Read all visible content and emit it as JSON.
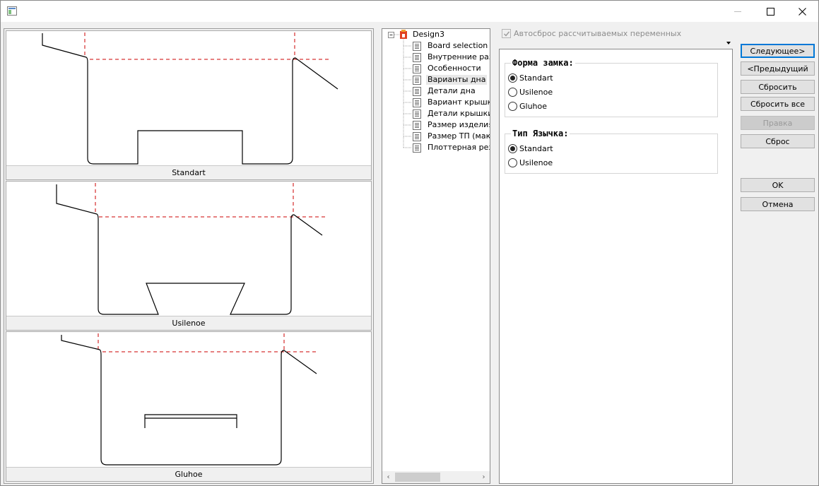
{
  "titlebar": {
    "icons": {
      "app": "app-window-icon",
      "minimize": "minimize-icon",
      "maximize": "maximize-icon",
      "close": "close-icon"
    }
  },
  "preview": {
    "items": [
      {
        "caption": "Standart"
      },
      {
        "caption": "Usilenoe"
      },
      {
        "caption": "Gluhoe"
      }
    ],
    "colors": {
      "outline": "#000000",
      "fold_line": "#cc0000"
    }
  },
  "tree": {
    "root": {
      "label": "Design3",
      "icon": "design-folder-icon"
    },
    "items": [
      {
        "label": "Board selection"
      },
      {
        "label": "Внутренние разме"
      },
      {
        "label": "Особенности"
      },
      {
        "label": "Варианты дна"
      },
      {
        "label": "Детали дна"
      },
      {
        "label": "Вариант крышки"
      },
      {
        "label": "Детали крышки"
      },
      {
        "label": "Размер изделия"
      },
      {
        "label": "Размер ТП (макс Г"
      },
      {
        "label": "Плоттерная резка"
      }
    ],
    "selected_index": 3,
    "scroll": {
      "left": "‹",
      "right": "›"
    }
  },
  "autoreset": {
    "label": "Автосброс рассчитываемых переменных",
    "checked": true
  },
  "options": {
    "lock_group": {
      "title": "Форма замка:",
      "options": [
        "Standart",
        "Usilenoe",
        "Gluhoe"
      ],
      "selected": "Standart"
    },
    "tongue_group": {
      "title": "Тип Язычка:",
      "options": [
        "Standart",
        "Usilenoe"
      ],
      "selected": "Standart"
    }
  },
  "buttons": {
    "next": "Следующее>",
    "prev": "<Предыдущий",
    "reset": "Сбросить",
    "reset_all": "Сбросить все",
    "edit": "Правка",
    "clear": "Сброс",
    "ok": "OK",
    "cancel": "Отмена"
  }
}
